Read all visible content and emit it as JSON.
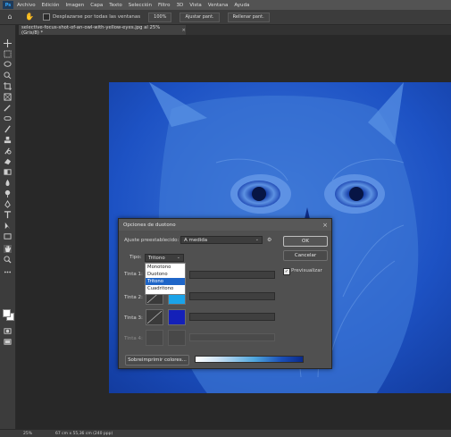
{
  "menu": {
    "logo": "Ps",
    "items": [
      "Archivo",
      "Edición",
      "Imagen",
      "Capa",
      "Texto",
      "Selección",
      "Filtro",
      "3D",
      "Vista",
      "Ventana",
      "Ayuda"
    ]
  },
  "options_bar": {
    "scroll_all_label": "Desplazarse por todas las ventanas",
    "zoom_label": "100%",
    "fit_label": "Ajustar pant.",
    "fill_label": "Rellenar pant."
  },
  "document": {
    "tab_title": "selective-focus-shot-of-an-owl-with-yellow-eyes.jpg al 25% (Gris/8) *"
  },
  "statusbar": {
    "zoom": "25%",
    "info": "67 cm x 55,36 cm (240 ppp)"
  },
  "dialog": {
    "title": "Opciones de duotono",
    "preset_label": "Ajuste preestablecido:",
    "preset_value": "A medida",
    "type_label": "Tipo:",
    "type_value": "Tritono",
    "ink1_label": "Tinta 1:",
    "ink2_label": "Tinta 2:",
    "ink3_label": "Tinta 3:",
    "ink4_label": "Tinta 4:",
    "ok_label": "OK",
    "cancel_label": "Cancelar",
    "preview_label": "Previsualizar",
    "overprint_label": "Sobreimprimir colores...",
    "type_options": [
      "Monotono",
      "Duotono",
      "Tritono",
      "Cuadritono"
    ],
    "selected_type_index": 2,
    "ink_colors": [
      "#000000",
      "#1aa3e8",
      "#1420b8"
    ]
  },
  "colors": {
    "photo_tint": "#1b4ec1",
    "accent": "#1f66c8"
  }
}
